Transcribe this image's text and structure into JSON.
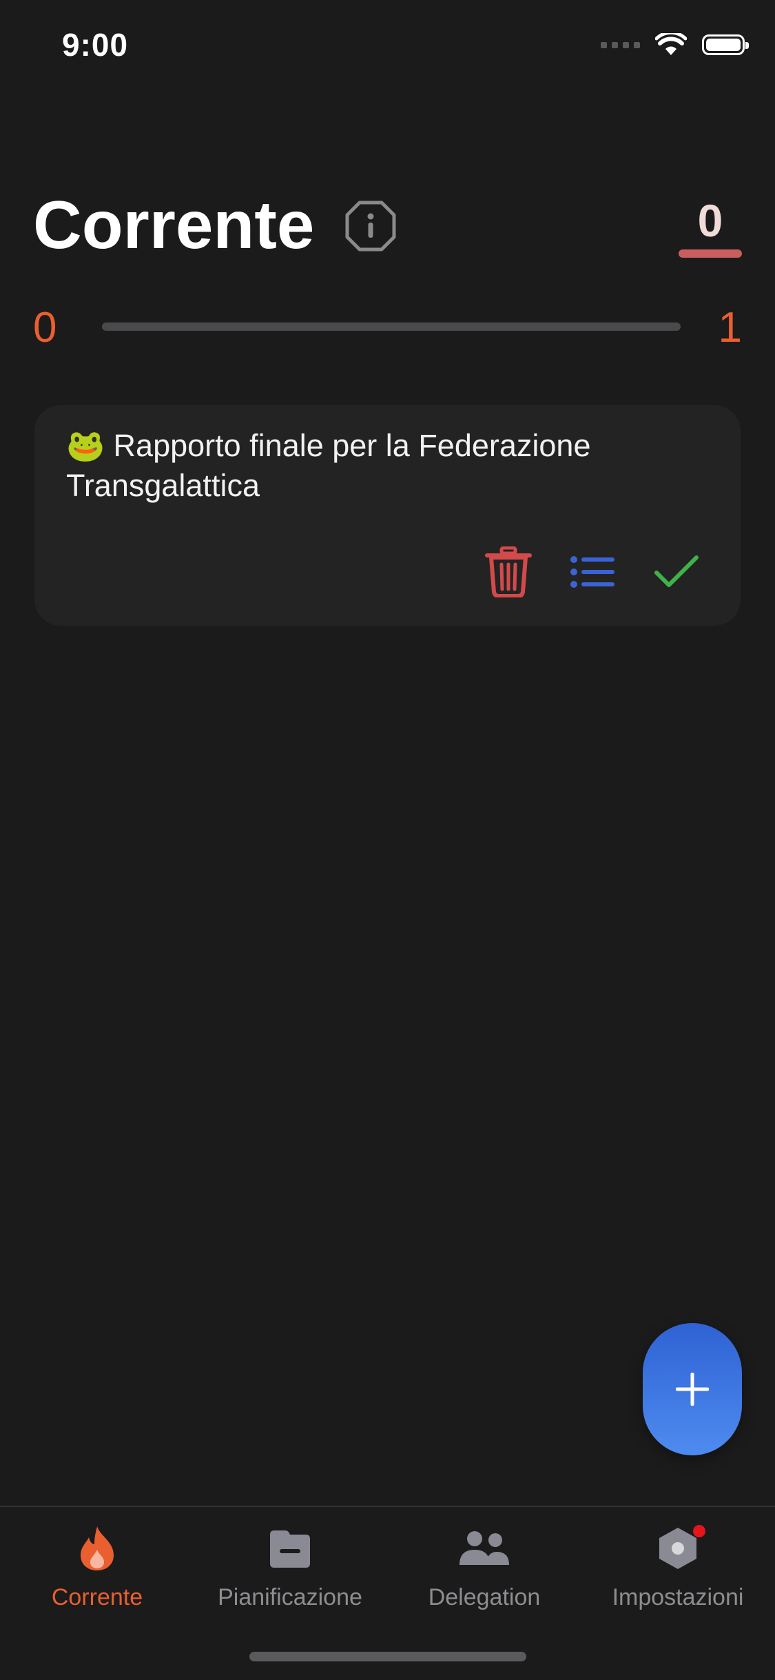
{
  "status_bar": {
    "time": "9:00"
  },
  "header": {
    "title": "Corrente",
    "counter": "0"
  },
  "progress": {
    "min_label": "0",
    "max_label": "1",
    "completed_fraction": 0
  },
  "task": {
    "emoji": "🐸",
    "text": "Rapporto finale per la Federazione Transgalattica"
  },
  "colors": {
    "accent": "#ea5f2f",
    "delete": "#d34a4a",
    "subtasks": "#3a63d6",
    "complete": "#3fb24a",
    "fab": "#3f78e6"
  },
  "tabs": [
    {
      "label": "Corrente",
      "icon": "flame-icon",
      "active": true
    },
    {
      "label": "Pianificazione",
      "icon": "folder-icon",
      "active": false
    },
    {
      "label": "Delegation",
      "icon": "people-icon",
      "active": false
    },
    {
      "label": "Impostazioni",
      "icon": "gear-icon",
      "active": false,
      "badge": true
    }
  ]
}
